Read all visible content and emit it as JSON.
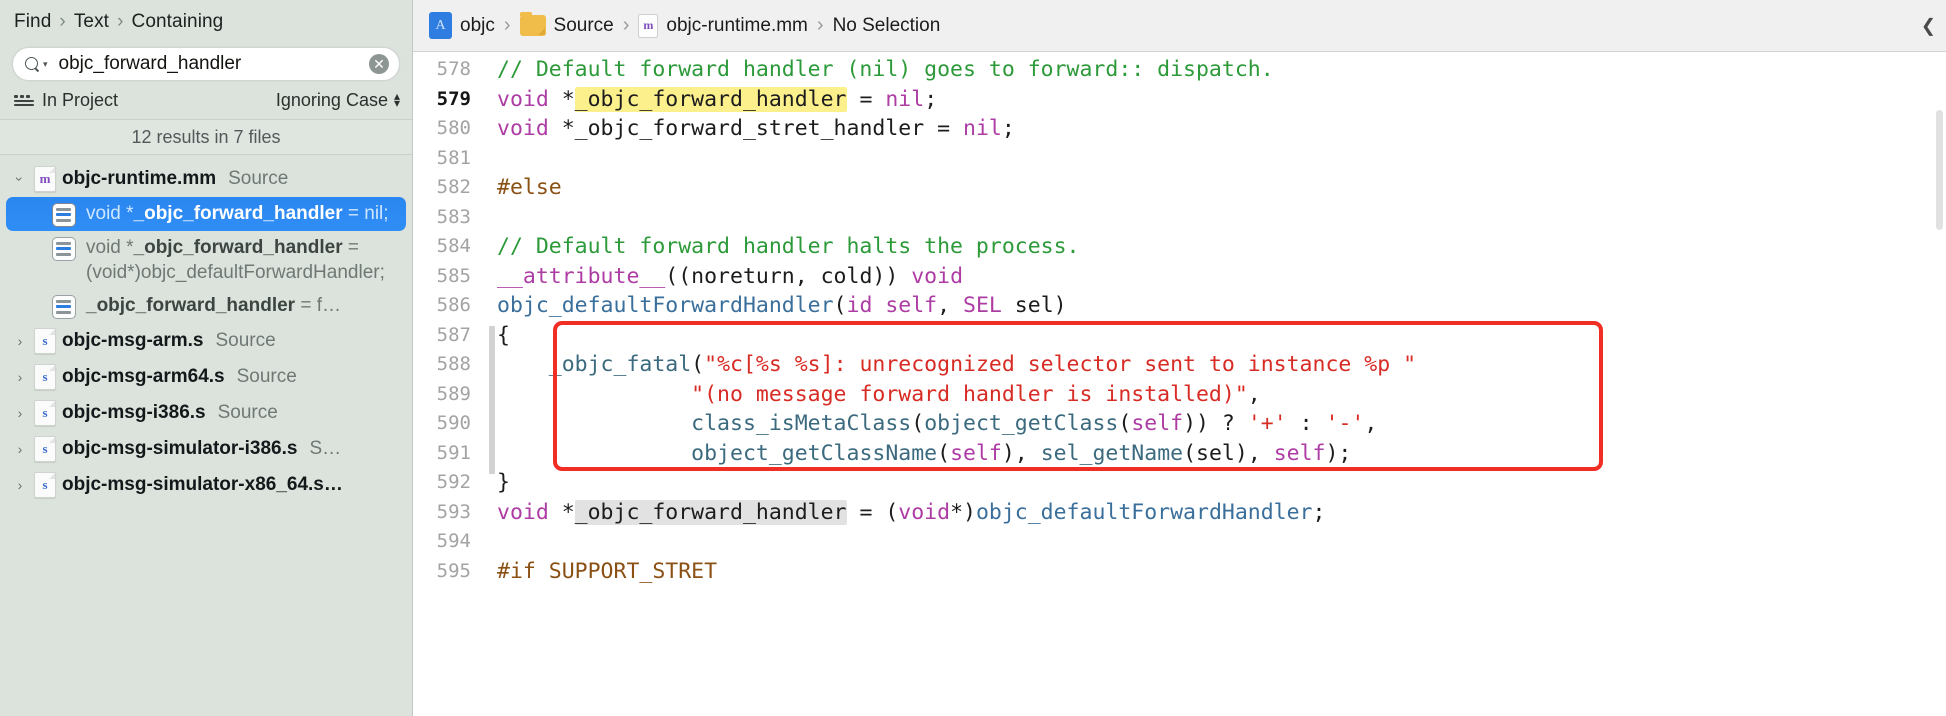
{
  "sidebar": {
    "breadcrumb": {
      "items": [
        "Find",
        "Text",
        "Containing"
      ],
      "separator": "›"
    },
    "search": {
      "value": "objc_forward_handler",
      "placeholder": "Search",
      "magnifier_icon": "search-icon",
      "dropdown_icon": "chevron-down-icon",
      "clear_icon": "✕",
      "clear_label": "clear-search"
    },
    "scope": {
      "icon": "scope-icon",
      "label": "In Project",
      "case_option": "Ignoring Case",
      "stepper_up": "▴",
      "stepper_down": "▾"
    },
    "results_count": "12 results in 7 files",
    "groups": [
      {
        "expanded": true,
        "disclosure": "›",
        "icon_letter": "m",
        "icon_kind": "mm",
        "name": "objc-runtime.mm",
        "kind": "Source",
        "matches": [
          {
            "selected": true,
            "prefix": "void *",
            "bold": "_objc_forward_handle",
            "bold2": "r",
            "suffix": " = nil;"
          },
          {
            "selected": false,
            "prefix": "void *",
            "bold": "_objc_forward_handle",
            "bold2": "r",
            "suffix": " = (void*)objc_defaultForwardHandler;"
          },
          {
            "selected": false,
            "prefix": "",
            "bold": "_objc_forward_handler",
            "bold2": "",
            "suffix": " = f…"
          }
        ]
      },
      {
        "expanded": false,
        "disclosure": "›",
        "icon_letter": "s",
        "icon_kind": "s",
        "name": "objc-msg-arm.s",
        "kind": "Source",
        "matches": []
      },
      {
        "expanded": false,
        "disclosure": "›",
        "icon_letter": "s",
        "icon_kind": "s",
        "name": "objc-msg-arm64.s",
        "kind": "Source",
        "matches": []
      },
      {
        "expanded": false,
        "disclosure": "›",
        "icon_letter": "s",
        "icon_kind": "s",
        "name": "objc-msg-i386.s",
        "kind": "Source",
        "matches": []
      },
      {
        "expanded": false,
        "disclosure": "›",
        "icon_letter": "s",
        "icon_kind": "s",
        "name": "objc-msg-simulator-i386.s",
        "kind": "S…",
        "matches": []
      },
      {
        "expanded": false,
        "disclosure": "›",
        "icon_letter": "s",
        "icon_kind": "s",
        "name": "objc-msg-simulator-x86_64.s…",
        "kind": "",
        "matches": []
      }
    ]
  },
  "editor": {
    "jumpbar": {
      "project": "objc",
      "folder": "Source",
      "file": "objc-runtime.mm",
      "file_icon_letter": "m",
      "selection": "No Selection",
      "separator": "›",
      "right_chevron": "❮"
    },
    "first_line": 578,
    "current_line": 579,
    "lines": [
      {
        "n": 578,
        "tokens": [
          {
            "t": "// Default forward handler (nil) goes to forward:: dispatch.",
            "c": "c-comment"
          }
        ]
      },
      {
        "n": 579,
        "tokens": [
          {
            "t": "void",
            "c": "c-kw"
          },
          {
            "t": " *",
            "c": "c-plain"
          },
          {
            "t": "_objc_forward_handler",
            "c": "c-plain",
            "hl": "yellow"
          },
          {
            "t": " = ",
            "c": "c-plain"
          },
          {
            "t": "nil",
            "c": "c-kw"
          },
          {
            "t": ";",
            "c": "c-plain"
          }
        ]
      },
      {
        "n": 580,
        "tokens": [
          {
            "t": "void",
            "c": "c-kw"
          },
          {
            "t": " *_objc_forward_stret_handler = ",
            "c": "c-plain"
          },
          {
            "t": "nil",
            "c": "c-kw"
          },
          {
            "t": ";",
            "c": "c-plain"
          }
        ]
      },
      {
        "n": 581,
        "tokens": []
      },
      {
        "n": 582,
        "tokens": [
          {
            "t": "#else",
            "c": "c-pp"
          }
        ]
      },
      {
        "n": 583,
        "tokens": []
      },
      {
        "n": 584,
        "tokens": [
          {
            "t": "// Default forward handler halts the process.",
            "c": "c-comment"
          }
        ]
      },
      {
        "n": 585,
        "tokens": [
          {
            "t": "__attribute__",
            "c": "c-kw"
          },
          {
            "t": "((noreturn, cold)) ",
            "c": "c-plain"
          },
          {
            "t": "void",
            "c": "c-kw"
          }
        ]
      },
      {
        "n": 586,
        "tokens": [
          {
            "t": "objc_defaultForwardHandler",
            "c": "c-type"
          },
          {
            "t": "(",
            "c": "c-plain"
          },
          {
            "t": "id",
            "c": "c-kw"
          },
          {
            "t": " ",
            "c": "c-plain"
          },
          {
            "t": "self",
            "c": "c-kw"
          },
          {
            "t": ", ",
            "c": "c-plain"
          },
          {
            "t": "SEL",
            "c": "c-kw"
          },
          {
            "t": " sel)",
            "c": "c-plain"
          }
        ]
      },
      {
        "n": 587,
        "tokens": [
          {
            "t": "{",
            "c": "c-plain"
          }
        ]
      },
      {
        "n": 588,
        "tokens": [
          {
            "t": "    _objc_fatal",
            "c": "c-fn"
          },
          {
            "t": "(",
            "c": "c-plain"
          },
          {
            "t": "\"%c[%s %s]: unrecognized selector sent to instance %p \"",
            "c": "c-str"
          }
        ]
      },
      {
        "n": 589,
        "tokens": [
          {
            "t": "               ",
            "c": "c-plain"
          },
          {
            "t": "\"(no message forward handler is installed)\"",
            "c": "c-str"
          },
          {
            "t": ",",
            "c": "c-plain"
          }
        ]
      },
      {
        "n": 590,
        "tokens": [
          {
            "t": "               ",
            "c": "c-plain"
          },
          {
            "t": "class_isMetaClass",
            "c": "c-fn"
          },
          {
            "t": "(",
            "c": "c-plain"
          },
          {
            "t": "object_getClass",
            "c": "c-fn"
          },
          {
            "t": "(",
            "c": "c-plain"
          },
          {
            "t": "self",
            "c": "c-kw"
          },
          {
            "t": ")) ? ",
            "c": "c-plain"
          },
          {
            "t": "'+'",
            "c": "c-str"
          },
          {
            "t": " : ",
            "c": "c-plain"
          },
          {
            "t": "'-'",
            "c": "c-str"
          },
          {
            "t": ",",
            "c": "c-plain"
          }
        ]
      },
      {
        "n": 591,
        "tokens": [
          {
            "t": "               ",
            "c": "c-plain"
          },
          {
            "t": "object_getClassName",
            "c": "c-fn"
          },
          {
            "t": "(",
            "c": "c-plain"
          },
          {
            "t": "self",
            "c": "c-kw"
          },
          {
            "t": "), ",
            "c": "c-plain"
          },
          {
            "t": "sel_getName",
            "c": "c-fn"
          },
          {
            "t": "(sel), ",
            "c": "c-plain"
          },
          {
            "t": "self",
            "c": "c-kw"
          },
          {
            "t": ");",
            "c": "c-plain"
          }
        ]
      },
      {
        "n": 592,
        "tokens": [
          {
            "t": "}",
            "c": "c-plain"
          }
        ]
      },
      {
        "n": 593,
        "tokens": [
          {
            "t": "void",
            "c": "c-kw"
          },
          {
            "t": " *",
            "c": "c-plain"
          },
          {
            "t": "_objc_forward_handler",
            "c": "c-plain",
            "hl": "gray"
          },
          {
            "t": " = (",
            "c": "c-plain"
          },
          {
            "t": "void",
            "c": "c-kw"
          },
          {
            "t": "*)",
            "c": "c-plain"
          },
          {
            "t": "objc_defaultForwardHandler",
            "c": "c-type"
          },
          {
            "t": ";",
            "c": "c-plain"
          }
        ]
      },
      {
        "n": 594,
        "tokens": []
      },
      {
        "n": 595,
        "tokens": [
          {
            "t": "#if SUPPORT_STRET",
            "c": "c-pp"
          }
        ]
      }
    ],
    "annotation": {
      "type": "red-rectangle",
      "color": "#f02e25"
    }
  },
  "colors": {
    "selection_blue": "#2a86f0",
    "sidebar_bg": "#dbe3dc",
    "highlight_yellow": "#fcf08c",
    "annotation_red": "#f02e25",
    "comment_green": "#2d9a3a",
    "keyword_magenta": "#ad3da4",
    "string_red": "#d72b24",
    "preproc_brown": "#8b5014"
  }
}
